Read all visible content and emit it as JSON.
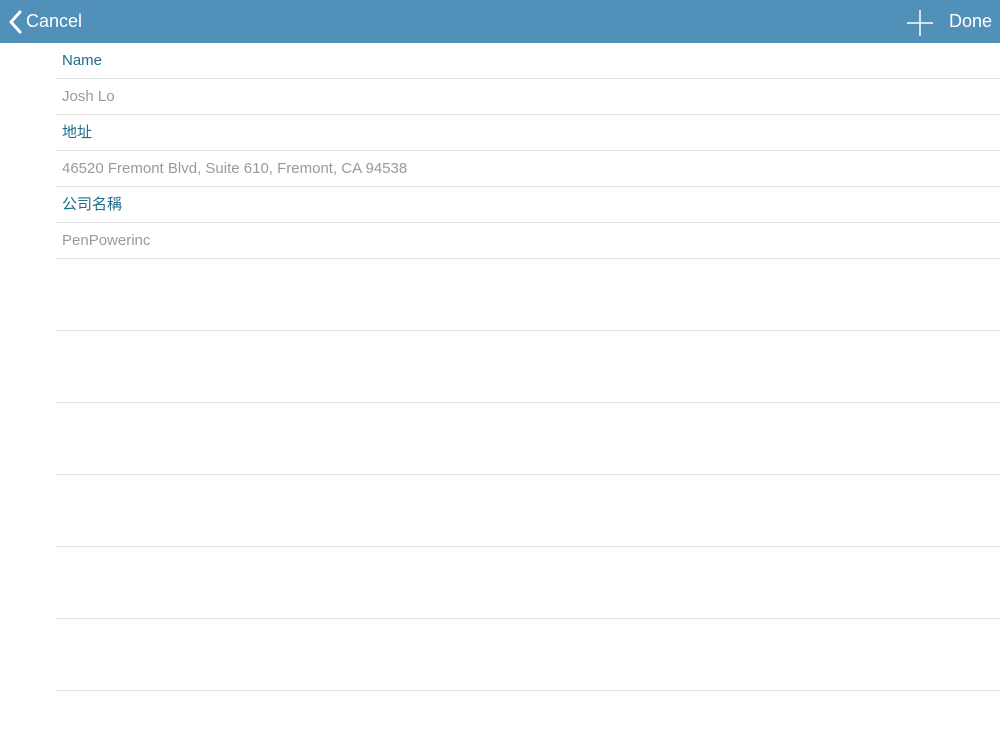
{
  "navbar": {
    "cancel_label": "Cancel",
    "done_label": "Done",
    "back_icon": "chevron-left-icon",
    "add_icon": "plus-icon",
    "background_color": "#5191b9"
  },
  "fields": [
    {
      "label": "Name",
      "value": "Josh Lo"
    },
    {
      "label": "地址",
      "value": "46520 Fremont Blvd, Suite 610, Fremont, CA 94538"
    },
    {
      "label": "公司名稱",
      "value": "PenPowerinc"
    }
  ],
  "colors": {
    "label": "#1f6f8b",
    "value": "#9a9a9a",
    "separator": "#e4e4e4"
  }
}
